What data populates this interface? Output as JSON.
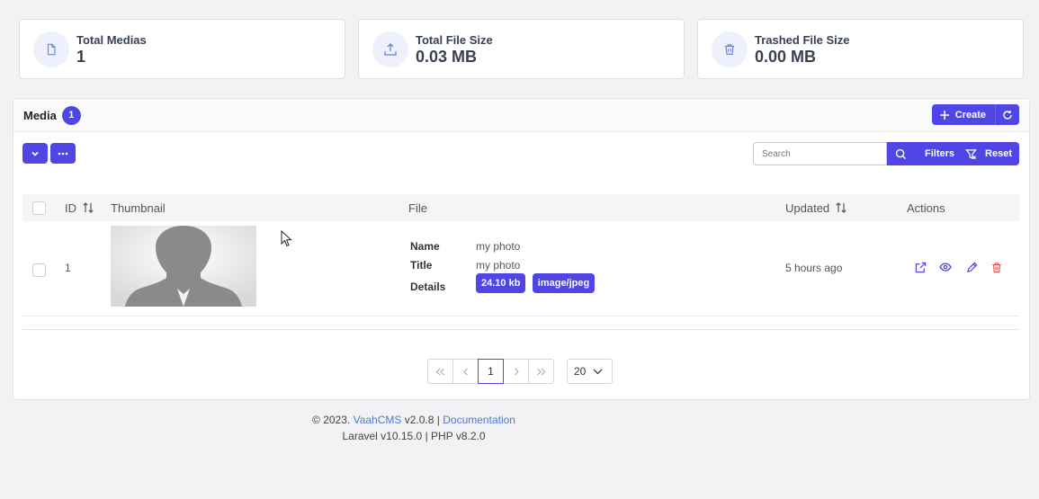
{
  "stats": [
    {
      "label": "Total Medias",
      "value": "1",
      "icon": "file-icon"
    },
    {
      "label": "Total File Size",
      "value": "0.03 MB",
      "icon": "upload-icon"
    },
    {
      "label": "Trashed File Size",
      "value": "0.00 MB",
      "icon": "trash-icon"
    }
  ],
  "panel": {
    "title": "Media",
    "count": "1",
    "create_label": "Create"
  },
  "search": {
    "placeholder": "Search",
    "filters_label": "Filters",
    "reset_label": "Reset"
  },
  "table": {
    "columns": {
      "id": "ID",
      "thumbnail": "Thumbnail",
      "file": "File",
      "updated": "Updated",
      "actions": "Actions"
    },
    "rows": [
      {
        "id": "1",
        "name_label": "Name",
        "name": "my photo",
        "title_label": "Title",
        "title": "my photo",
        "details_label": "Details",
        "size": "24.10 kb",
        "mime": "image/jpeg",
        "updated": "5 hours ago"
      }
    ]
  },
  "pagination": {
    "current": "1",
    "per_page": "20"
  },
  "footer": {
    "copyright": "© 2023.",
    "app_link": "VaahCMS",
    "version": "v2.0.8",
    "sep": "|",
    "docs_link": "Documentation",
    "laravel": "Laravel v10.15.0",
    "php": "PHP v8.2.0"
  },
  "colors": {
    "accent": "#4f46e5",
    "danger": "#e5484d"
  }
}
